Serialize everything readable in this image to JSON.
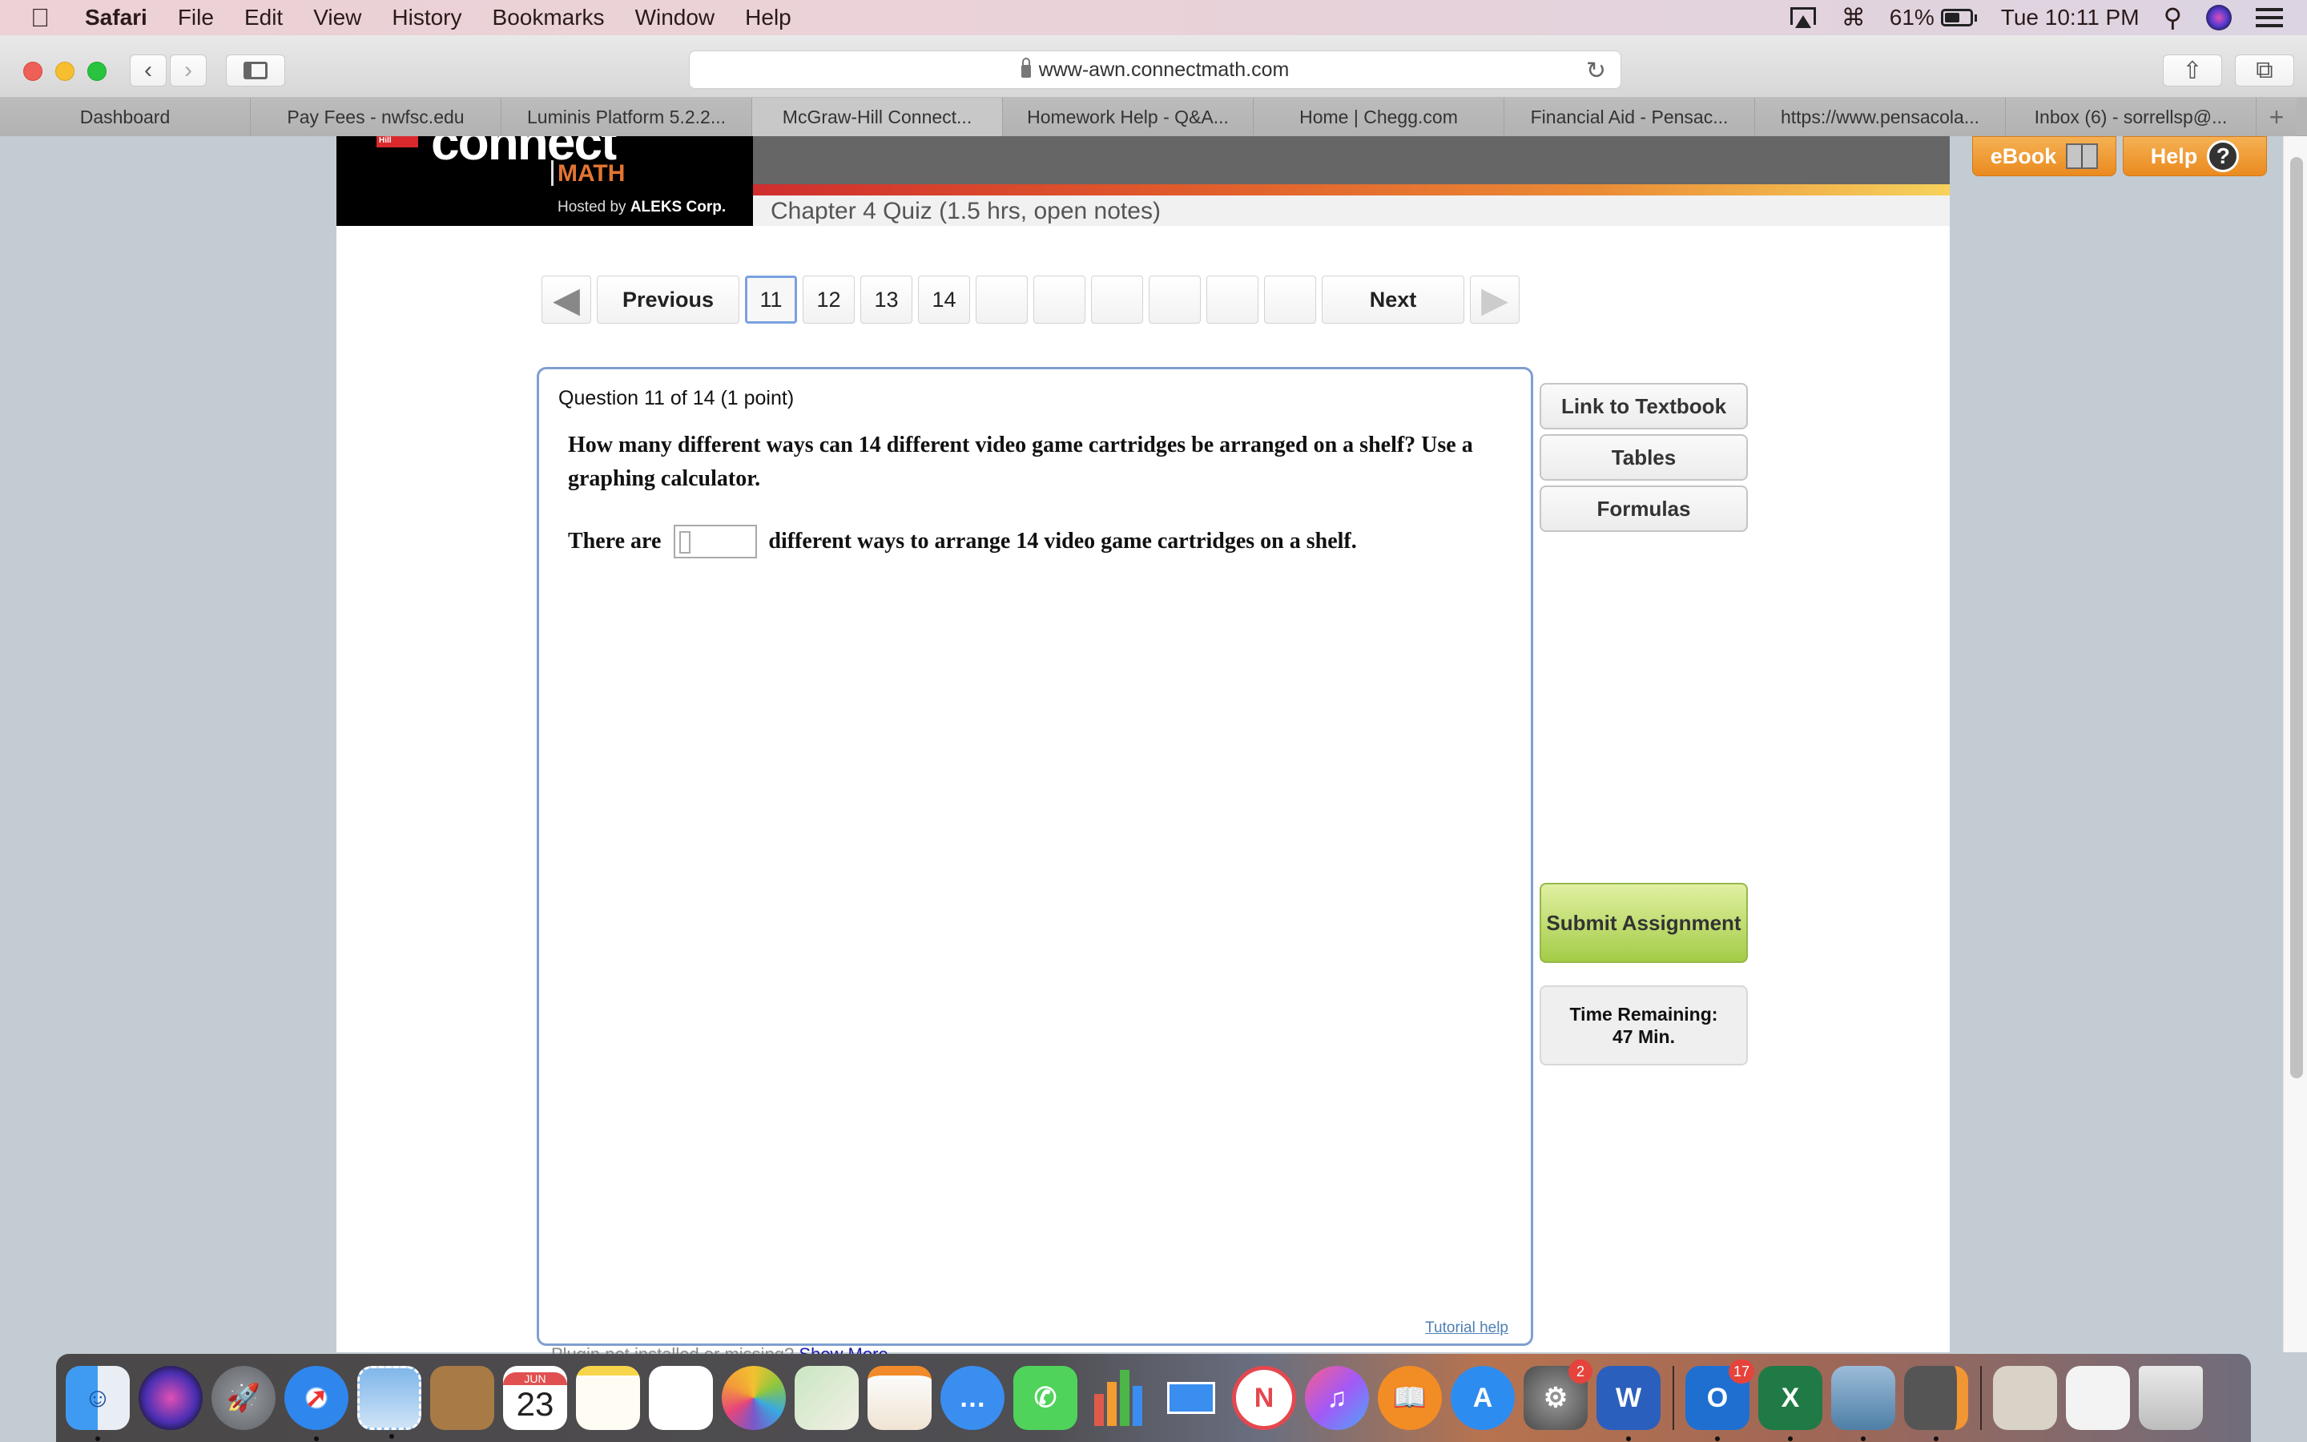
{
  "menubar": {
    "app_name": "Safari",
    "items": [
      "File",
      "Edit",
      "View",
      "History",
      "Bookmarks",
      "Window",
      "Help"
    ],
    "battery_percent": "61%",
    "battery_level": 0.61,
    "clock": "Tue 10:11 PM"
  },
  "browser": {
    "url": "www-awn.connectmath.com",
    "tabs": [
      {
        "label": "Dashboard",
        "active": false
      },
      {
        "label": "Pay Fees - nwfsc.edu",
        "active": false
      },
      {
        "label": "Luminis Platform 5.2.2...",
        "active": false
      },
      {
        "label": "McGraw-Hill Connect...",
        "active": true
      },
      {
        "label": "Homework Help - Q&A...",
        "active": false
      },
      {
        "label": "Home | Chegg.com",
        "active": false
      },
      {
        "label": "Financial Aid - Pensac...",
        "active": false
      },
      {
        "label": "https://www.pensacola...",
        "active": false
      },
      {
        "label": "Inbox (6) - sorrellsp@...",
        "active": false
      }
    ],
    "new_tab_label": "+"
  },
  "header": {
    "logo_mcgraw": "Hill",
    "logo_connect": "connect",
    "logo_math": "MATH",
    "hosted_by_prefix": "Hosted by",
    "hosted_by_company": "ALEKS Corp.",
    "ebook_label": "eBook",
    "help_label": "Help",
    "quiz_title": "Chapter 4 Quiz (1.5 hrs, open notes)",
    "colors": {
      "accent_orange": "#ea8a1f",
      "math_orange": "#e27532"
    }
  },
  "pager": {
    "previous_label": "Previous",
    "next_label": "Next",
    "pages": [
      "11",
      "12",
      "13",
      "14",
      "",
      "",
      "",
      "",
      "",
      ""
    ],
    "current_page": "11"
  },
  "question": {
    "header": "Question 11 of 14 (1 point)",
    "text": "How many different ways can 14 different video game cartridges be arranged on a shelf? Use a graphing calculator.",
    "answer_prefix": "There are",
    "answer_value": "",
    "answer_suffix": "different ways to arrange 14 video game cartridges on a shelf.",
    "tutorial_help": "Tutorial help"
  },
  "sidebar": {
    "link_textbook": "Link to Textbook",
    "tables": "Tables",
    "formulas": "Formulas",
    "submit": "Submit Assignment",
    "time_label": "Time Remaining:",
    "time_value": "47 Min.",
    "submit_color": "#a4cc47"
  },
  "footer": {
    "plugin_text": "Plugin not installed or missing?",
    "show_more": "Show More"
  },
  "dock": {
    "calendar_month": "JUN",
    "calendar_day": "23",
    "settings_badge": "2",
    "outlook_badge": "17",
    "apps": [
      "Finder",
      "Siri",
      "Launchpad",
      "Safari",
      "Mail",
      "Contacts",
      "Calendar",
      "Notes",
      "Reminders",
      "Photos",
      "Maps",
      "Pages",
      "Messages",
      "FaceTime",
      "Numbers",
      "Keynote",
      "News",
      "iTunes",
      "Books",
      "App Store",
      "System Preferences",
      "Microsoft Word",
      "Microsoft Outlook",
      "Microsoft Excel",
      "Preview",
      "Calculator",
      "Documents",
      "Downloads",
      "Trash"
    ]
  }
}
